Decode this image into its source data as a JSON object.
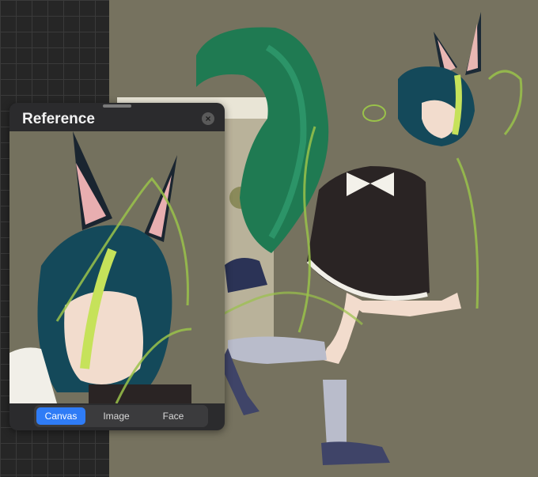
{
  "reference_panel": {
    "title": "Reference",
    "close_glyph": "×",
    "tabs": [
      {
        "label": "Canvas",
        "active": true
      },
      {
        "label": "Image",
        "active": false
      },
      {
        "label": "Face",
        "active": false
      }
    ]
  },
  "icons": {
    "close": "close-icon",
    "drag": "drag-handle-icon"
  },
  "colors": {
    "accent": "#2f7cf6",
    "panel": "#2b2b2d",
    "canvas": "#76725f",
    "hair": "#14495a",
    "highlight": "#c6e25a",
    "tail": "#1f7a52"
  }
}
